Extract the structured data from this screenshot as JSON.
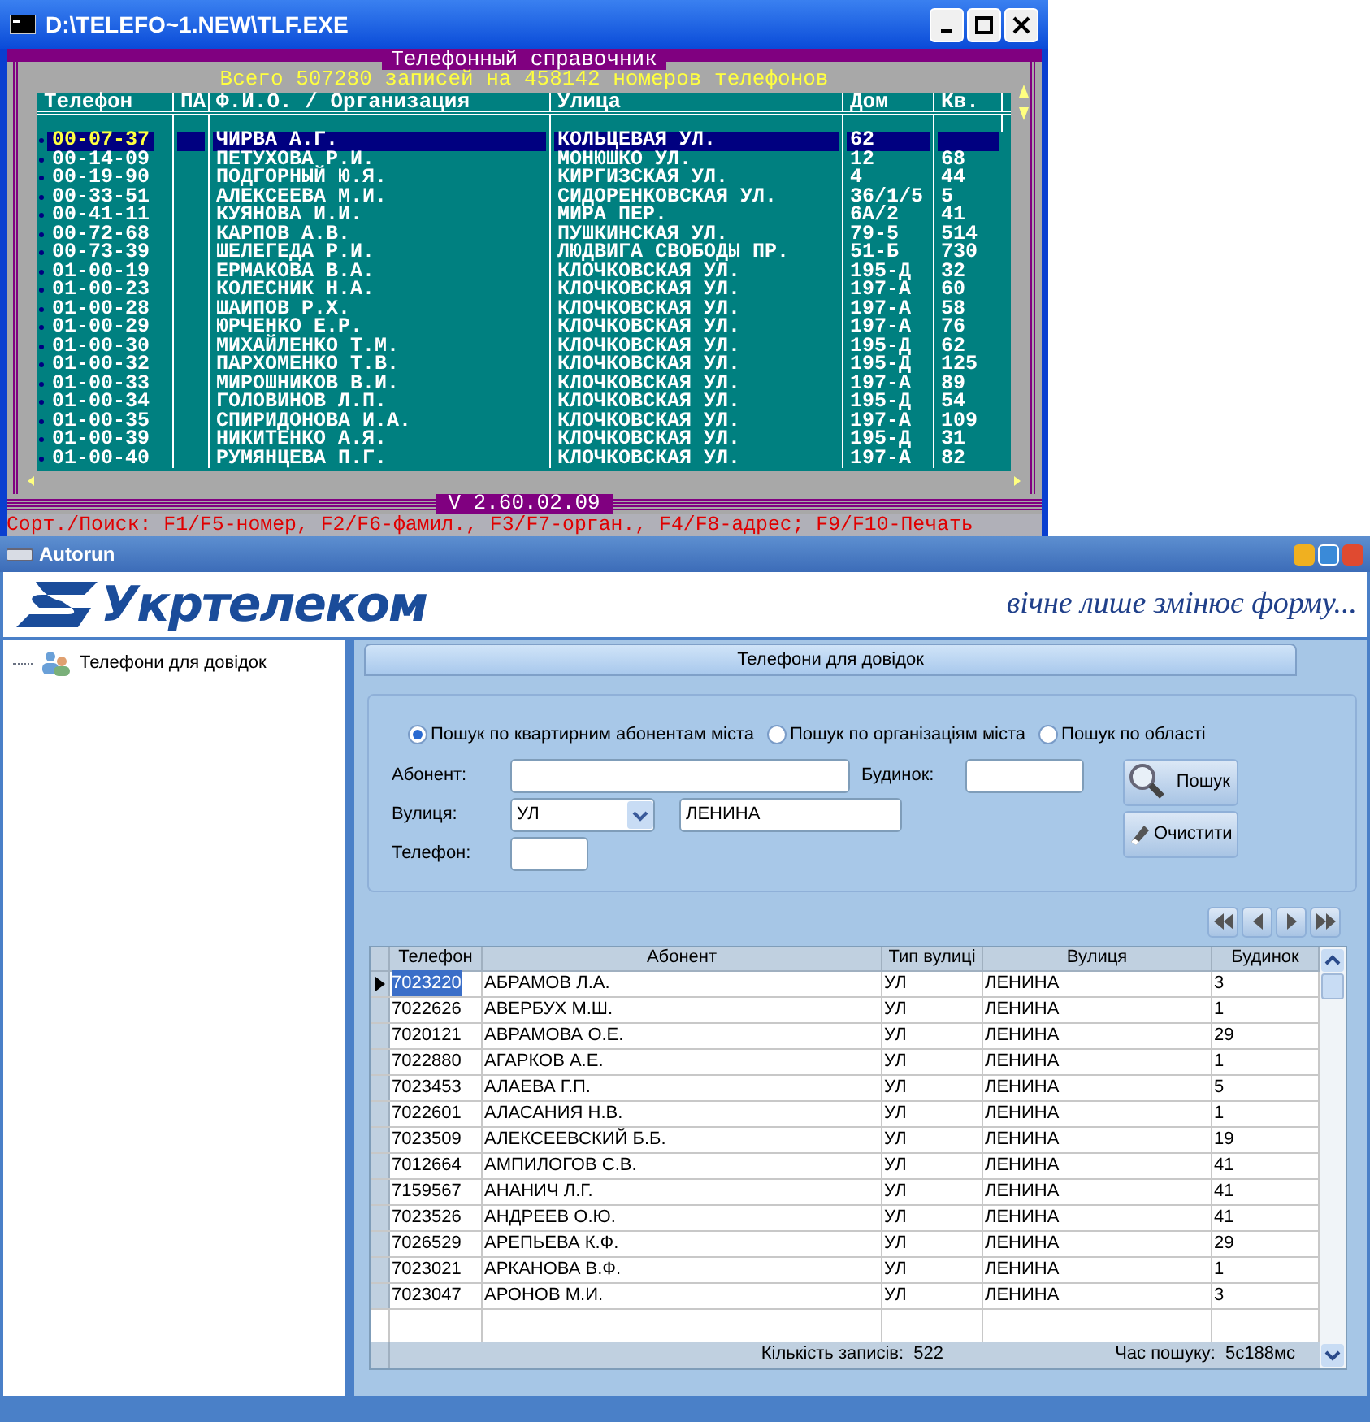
{
  "console": {
    "title": "D:\\TELEFO~1.NEW\\TLF.EXE",
    "heading": "Телефонный справочник",
    "summary": "Всего 507280 записей на 458142 номеров телефонов",
    "columns": [
      "Телефон",
      "ПА",
      "Ф.И.О. / Организация",
      "Улица",
      "Дом",
      "Кв."
    ],
    "rows": [
      {
        "phone": "00-07-37",
        "name": "ЧИРВА А.Г.",
        "street": "КОЛЬЦЕВАЯ УЛ.",
        "house": "62",
        "selected": true
      },
      {
        "phone": "00-14-09",
        "name": "ПЕТУХОВА Р.И.",
        "street": "МОНЮШКО УЛ.",
        "house": "12",
        "apt": "68",
        "selected": false
      },
      {
        "phone": "00-19-90",
        "name": "ПОДГОРНЫЙ Ю.Я.",
        "street": "КИРГИЗСКАЯ УЛ.",
        "house": "4",
        "apt": "44",
        "selected": false
      },
      {
        "phone": "00-33-51",
        "name": "АЛЕКСЕЕВА М.И.",
        "street": "СИДОРЕНКОВСКАЯ УЛ.",
        "house": "36/1/5",
        "apt": "5",
        "selected": false
      },
      {
        "phone": "00-41-11",
        "name": "КУЯНОВА И.И.",
        "street": "МИРА ПЕР.",
        "house": "6А/2",
        "apt": "41",
        "selected": false
      },
      {
        "phone": "00-72-68",
        "name": "КАРПОВ А.В.",
        "street": "ПУШКИНСКАЯ УЛ.",
        "house": "79-5",
        "apt": "514",
        "selected": false
      },
      {
        "phone": "00-73-39",
        "name": "ШЕЛЕГЕДА Р.И.",
        "street": "ЛЮДВИГА СВОБОДЫ ПР.",
        "house": "51-Б",
        "apt": "730",
        "selected": false
      },
      {
        "phone": "01-00-19",
        "name": "ЕРМАКОВА В.А.",
        "street": "КЛОЧКОВСКАЯ УЛ.",
        "house": "195-Д",
        "apt": "32",
        "selected": false
      },
      {
        "phone": "01-00-23",
        "name": "КОЛЕСНИК Н.А.",
        "street": "КЛОЧКОВСКАЯ УЛ.",
        "house": "197-А",
        "apt": "60",
        "selected": false
      },
      {
        "phone": "01-00-28",
        "name": "ШАИПОВ Р.Х.",
        "street": "КЛОЧКОВСКАЯ УЛ.",
        "house": "197-А",
        "apt": "58",
        "selected": false
      },
      {
        "phone": "01-00-29",
        "name": "ЮРЧЕНКО Е.Р.",
        "street": "КЛОЧКОВСКАЯ УЛ.",
        "house": "197-А",
        "apt": "76",
        "selected": false
      },
      {
        "phone": "01-00-30",
        "name": "МИХАЙЛЕНКО Т.М.",
        "street": "КЛОЧКОВСКАЯ УЛ.",
        "house": "195-Д",
        "apt": "62",
        "selected": false
      },
      {
        "phone": "01-00-32",
        "name": "ПАРХОМЕНКО Т.В.",
        "street": "КЛОЧКОВСКАЯ УЛ.",
        "house": "195-Д",
        "apt": "125",
        "selected": false
      },
      {
        "phone": "01-00-33",
        "name": "МИРОШНИКОВ В.И.",
        "street": "КЛОЧКОВСКАЯ УЛ.",
        "house": "197-А",
        "apt": "89",
        "selected": false
      },
      {
        "phone": "01-00-34",
        "name": "ГОЛОВИНОВ Л.П.",
        "street": "КЛОЧКОВСКАЯ УЛ.",
        "house": "195-Д",
        "apt": "54",
        "selected": false
      },
      {
        "phone": "01-00-35",
        "name": "СПИРИДОНОВА И.А.",
        "street": "КЛОЧКОВСКАЯ УЛ.",
        "house": "197-А",
        "apt": "109",
        "selected": false
      },
      {
        "phone": "01-00-39",
        "name": "НИКИТЕНКО А.Я.",
        "street": "КЛОЧКОВСКАЯ УЛ.",
        "house": "195-Д",
        "apt": "31",
        "selected": false
      },
      {
        "phone": "01-00-40",
        "name": "РУМЯНЦЕВА П.Г.",
        "street": "КЛОЧКОВСКАЯ УЛ.",
        "house": "197-А",
        "apt": "82",
        "selected": false
      }
    ],
    "version": "V 2.60.02.09",
    "hint": "Сорт./Поиск: F1/F5-номер, F2/F6-фамил., F3/F7-орган., F4/F8-адрес; F9/F10-Печать"
  },
  "app": {
    "title": "Autorun",
    "logo": "Укртелеком",
    "slogan": "вічне лише змінює форму...",
    "tree": [
      {
        "label": "Телефони для довідок",
        "selected": false
      }
    ],
    "tab": "Телефони для довідок",
    "search_modes": [
      {
        "label": "Пошук по квартирним абонентам міста",
        "selected": true
      },
      {
        "label": "Пошук по організаціям міста",
        "selected": false
      },
      {
        "label": "Пошук по області",
        "selected": false
      }
    ],
    "subscriber_label": "Абонент:",
    "building_label": "Будинок:",
    "street_label": "Вулиця:",
    "street_type": "УЛ",
    "street_value": "ЛЕНИНА",
    "phone_label": "Телефон:",
    "search_button": "Пошук",
    "clear_button": "Очистити",
    "columns": [
      "Телефон",
      "Абонент",
      "Тип вулиці",
      "Вулиця",
      "Будинок"
    ],
    "rows": [
      {
        "cells": [
          "7023220",
          "АБРАМОВ Л.А.",
          "УЛ",
          "ЛЕНИНА",
          "3"
        ],
        "selected": true
      },
      {
        "cells": [
          "7022626",
          "АВЕРБУХ М.Ш.",
          "УЛ",
          "ЛЕНИНА",
          "1"
        ],
        "selected": false
      },
      {
        "cells": [
          "7020121",
          "АВРАМОВА О.Е.",
          "УЛ",
          "ЛЕНИНА",
          "29"
        ],
        "selected": false
      },
      {
        "cells": [
          "7022880",
          "АГАРКОВ А.Е.",
          "УЛ",
          "ЛЕНИНА",
          "1"
        ],
        "selected": false
      },
      {
        "cells": [
          "7023453",
          "АЛАЕВА Г.П.",
          "УЛ",
          "ЛЕНИНА",
          "5"
        ],
        "selected": false
      },
      {
        "cells": [
          "7022601",
          "АЛАСАНИЯ Н.В.",
          "УЛ",
          "ЛЕНИНА",
          "1"
        ],
        "selected": false
      },
      {
        "cells": [
          "7023509",
          "АЛЕКСЕЕВСКИЙ Б.Б.",
          "УЛ",
          "ЛЕНИНА",
          "19"
        ],
        "selected": false
      },
      {
        "cells": [
          "7012664",
          "АМПИЛОГОВ С.В.",
          "УЛ",
          "ЛЕНИНА",
          "41"
        ],
        "selected": false
      },
      {
        "cells": [
          "7159567",
          "АНАНИЧ Л.Г.",
          "УЛ",
          "ЛЕНИНА",
          "41"
        ],
        "selected": false
      },
      {
        "cells": [
          "7023526",
          "АНДРЕЕВ О.Ю.",
          "УЛ",
          "ЛЕНИНА",
          "41"
        ],
        "selected": false
      },
      {
        "cells": [
          "7026529",
          "АРЕПЬЕВА К.Ф.",
          "УЛ",
          "ЛЕНИНА",
          "29"
        ],
        "selected": false
      },
      {
        "cells": [
          "7023021",
          "АРКАНОВА В.Ф.",
          "УЛ",
          "ЛЕНИНА",
          "1"
        ],
        "selected": false
      },
      {
        "cells": [
          "7023047",
          "АРОНОВ М.И.",
          "УЛ",
          "ЛЕНИНА",
          "3"
        ],
        "selected": false
      }
    ],
    "count_label": "Кількість записів:",
    "count": "522",
    "time_label": "Час пошуку:",
    "time": "5с188мс"
  }
}
